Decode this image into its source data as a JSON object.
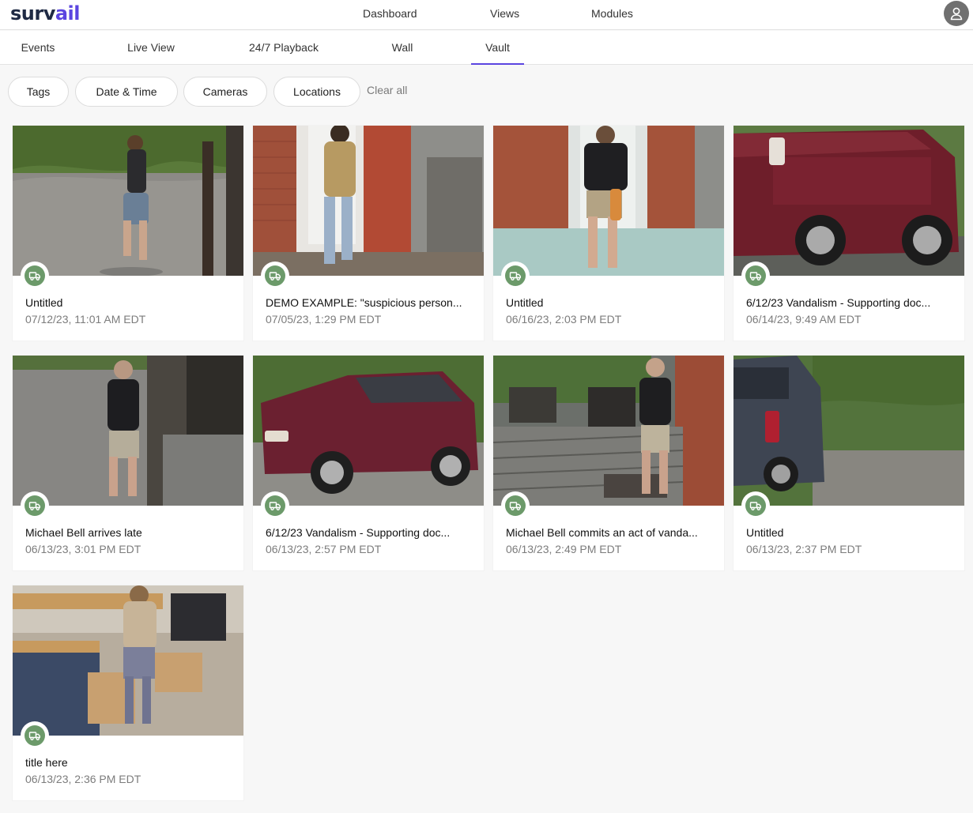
{
  "app": {
    "logo_text_a": "surv",
    "logo_text_b": "ail",
    "accent_color": "#5b45e0",
    "badge_color": "#6c9a6a"
  },
  "topnav": {
    "items": [
      {
        "label": "Dashboard"
      },
      {
        "label": "Views"
      },
      {
        "label": "Modules"
      }
    ],
    "avatar_icon": "user-icon"
  },
  "tabs": {
    "items": [
      {
        "label": "Events"
      },
      {
        "label": "Live View"
      },
      {
        "label": "24/7 Playback"
      },
      {
        "label": "Wall"
      },
      {
        "label": "Vault"
      }
    ],
    "active": "Vault"
  },
  "filters": {
    "items": [
      {
        "label": "Tags"
      },
      {
        "label": "Date & Time"
      },
      {
        "label": "Cameras"
      },
      {
        "label": "Locations"
      }
    ],
    "clear_label": "Clear all"
  },
  "vault": {
    "badge_icon": "truck-icon",
    "cards": [
      {
        "title": "Untitled",
        "date": "07/12/23, 11:01 AM EDT"
      },
      {
        "title": "DEMO EXAMPLE: \"suspicious person...",
        "date": "07/05/23, 1:29 PM EDT"
      },
      {
        "title": "Untitled",
        "date": "06/16/23, 2:03 PM EDT"
      },
      {
        "title": "6/12/23 Vandalism - Supporting doc...",
        "date": "06/14/23, 9:49 AM EDT"
      },
      {
        "title": "Michael Bell arrives late",
        "date": "06/13/23, 3:01 PM EDT"
      },
      {
        "title": "6/12/23 Vandalism - Supporting doc...",
        "date": "06/13/23, 2:57 PM EDT"
      },
      {
        "title": "Michael Bell commits an act of vanda...",
        "date": "06/13/23, 2:49 PM EDT"
      },
      {
        "title": "Untitled",
        "date": "06/13/23, 2:37 PM EDT"
      },
      {
        "title": "title here",
        "date": "06/13/23, 2:36 PM EDT"
      }
    ]
  }
}
